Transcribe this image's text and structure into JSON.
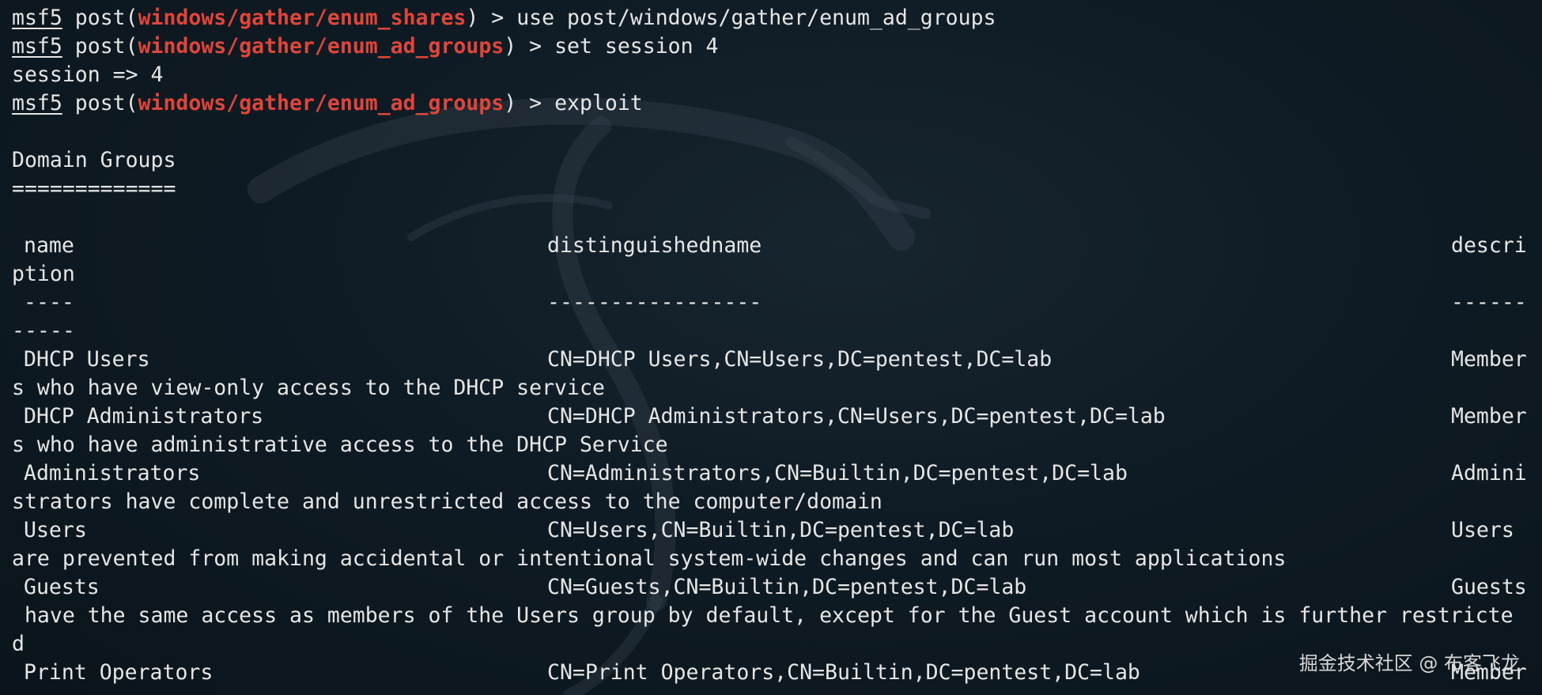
{
  "colors": {
    "background": "#0e1a22",
    "text": "#e6e6e6",
    "module": "#e0453a"
  },
  "icons": {
    "watermark_logo": "kali-dragon-icon"
  },
  "commands": [
    {
      "prompt": "msf5",
      "module": "windows/gather/enum_shares",
      "command": "use post/windows/gather/enum_ad_groups"
    },
    {
      "prompt": "msf5",
      "module": "windows/gather/enum_ad_groups",
      "command": "set session 4"
    },
    {
      "output": "session => 4"
    },
    {
      "prompt": "msf5",
      "module": "windows/gather/enum_ad_groups",
      "command": "exploit"
    }
  ],
  "prompt_parts": {
    "post_open": " post(",
    "close": ") > "
  },
  "section": {
    "title": "Domain Groups",
    "underline": "============="
  },
  "table": {
    "headers": {
      "name": "name",
      "dn": "distinguishedname",
      "desc_part1": "descri",
      "desc_part2": "ption"
    },
    "separators": {
      "name": "----",
      "dn": "-----------------",
      "desc_part1": "------",
      "desc_part2": "-----"
    },
    "rows": [
      {
        "name": "DHCP Users",
        "dn": "CN=DHCP Users,CN=Users,DC=pentest,DC=lab",
        "desc_part1": "Member",
        "desc_part2": "s who have view-only access to the DHCP service"
      },
      {
        "name": "DHCP Administrators",
        "dn": "CN=DHCP Administrators,CN=Users,DC=pentest,DC=lab",
        "desc_part1": "Member",
        "desc_part2": "s who have administrative access to the DHCP Service"
      },
      {
        "name": "Administrators",
        "dn": "CN=Administrators,CN=Builtin,DC=pentest,DC=lab",
        "desc_part1": "Admini",
        "desc_part2": "strators have complete and unrestricted access to the computer/domain"
      },
      {
        "name": "Users",
        "dn": "CN=Users,CN=Builtin,DC=pentest,DC=lab",
        "desc_part1": "Users",
        "desc_part2": "are prevented from making accidental or intentional system-wide changes and can run most applications"
      },
      {
        "name": "Guests",
        "dn": "CN=Guests,CN=Builtin,DC=pentest,DC=lab",
        "desc_part1": "Guests",
        "desc_part2": " have the same access as members of the Users group by default, except for the Guest account which is further restricte",
        "desc_part3": "d"
      },
      {
        "name": "Print Operators",
        "dn": "CN=Print Operators,CN=Builtin,DC=pentest,DC=lab",
        "desc_part1": "Member"
      }
    ]
  },
  "watermark": "掘金技术社区 @ 布客飞龙"
}
